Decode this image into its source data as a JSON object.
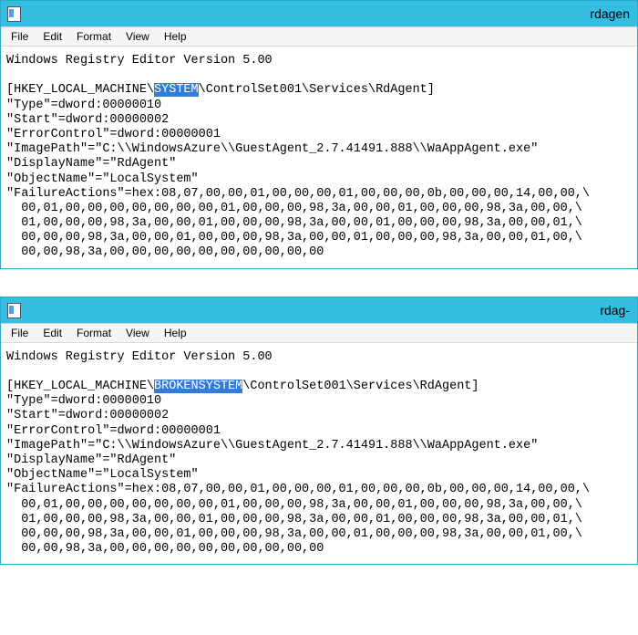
{
  "windows": [
    {
      "title": "rdagen",
      "menu": [
        "File",
        "Edit",
        "Format",
        "View",
        "Help"
      ],
      "content": {
        "header": "Windows Registry Editor Version 5.00",
        "reg_prefix": "[HKEY_LOCAL_MACHINE\\",
        "reg_selected": "SYSTEM",
        "reg_suffix": "\\ControlSet001\\Services\\RdAgent]",
        "lines": [
          "\"Type\"=dword:00000010",
          "\"Start\"=dword:00000002",
          "\"ErrorControl\"=dword:00000001",
          "\"ImagePath\"=\"C:\\\\WindowsAzure\\\\GuestAgent_2.7.41491.888\\\\WaAppAgent.exe\"",
          "\"DisplayName\"=\"RdAgent\"",
          "\"ObjectName\"=\"LocalSystem\"",
          "\"FailureActions\"=hex:08,07,00,00,01,00,00,00,01,00,00,00,0b,00,00,00,14,00,00,\\",
          "  00,01,00,00,00,00,00,00,00,01,00,00,00,98,3a,00,00,01,00,00,00,98,3a,00,00,\\",
          "  01,00,00,00,98,3a,00,00,01,00,00,00,98,3a,00,00,01,00,00,00,98,3a,00,00,01,\\",
          "  00,00,00,98,3a,00,00,01,00,00,00,98,3a,00,00,01,00,00,00,98,3a,00,00,01,00,\\",
          "  00,00,98,3a,00,00,00,00,00,00,00,00,00,00"
        ]
      }
    },
    {
      "title": "rdag- ",
      "menu": [
        "File",
        "Edit",
        "Format",
        "View",
        "Help"
      ],
      "content": {
        "header": "Windows Registry Editor Version 5.00",
        "reg_prefix": "[HKEY_LOCAL_MACHINE\\",
        "reg_selected": "BROKENSYSTEM",
        "reg_suffix": "\\ControlSet001\\Services\\RdAgent]",
        "lines": [
          "\"Type\"=dword:00000010",
          "\"Start\"=dword:00000002",
          "\"ErrorControl\"=dword:00000001",
          "\"ImagePath\"=\"C:\\\\WindowsAzure\\\\GuestAgent_2.7.41491.888\\\\WaAppAgent.exe\"",
          "\"DisplayName\"=\"RdAgent\"",
          "\"ObjectName\"=\"LocalSystem\"",
          "\"FailureActions\"=hex:08,07,00,00,01,00,00,00,01,00,00,00,0b,00,00,00,14,00,00,\\",
          "  00,01,00,00,00,00,00,00,00,01,00,00,00,98,3a,00,00,01,00,00,00,98,3a,00,00,\\",
          "  01,00,00,00,98,3a,00,00,01,00,00,00,98,3a,00,00,01,00,00,00,98,3a,00,00,01,\\",
          "  00,00,00,98,3a,00,00,01,00,00,00,98,3a,00,00,01,00,00,00,98,3a,00,00,01,00,\\",
          "  00,00,98,3a,00,00,00,00,00,00,00,00,00,00"
        ]
      }
    }
  ]
}
